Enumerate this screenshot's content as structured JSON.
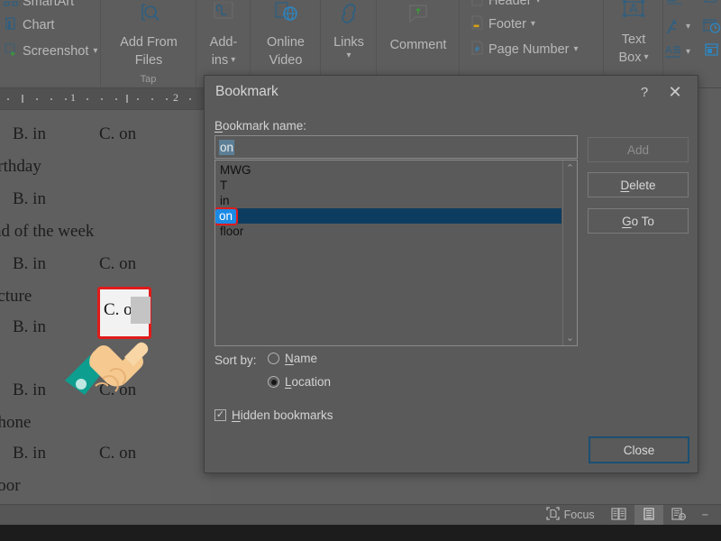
{
  "ribbon": {
    "groups": [
      {
        "name": "illustrations-group",
        "label": "",
        "items": [
          "SmartArt",
          "Chart",
          "Screenshot"
        ]
      },
      {
        "name": "tap-group",
        "label": "Tap",
        "items": [
          "Add From Files"
        ]
      },
      {
        "name": "addins-group",
        "label": "",
        "items": [
          "Add-ins"
        ]
      },
      {
        "name": "media-group",
        "label": "",
        "items": [
          "Online Video"
        ]
      },
      {
        "name": "links-group",
        "label": "",
        "items": [
          "Links"
        ]
      },
      {
        "name": "comments-group",
        "label": "",
        "items": [
          "Comment"
        ]
      },
      {
        "name": "header-footer-group",
        "label": "",
        "items": [
          "Header",
          "Footer",
          "Page Number"
        ]
      },
      {
        "name": "text-group",
        "label": "",
        "items": [
          "Text Box"
        ]
      }
    ],
    "smartart_label": "SmartArt",
    "chart_label": "Chart",
    "screenshot_label": "Screenshot",
    "add_from_files_label": "Add From\nFiles",
    "add_from_files_line1": "Add From",
    "add_from_files_line2": "Files",
    "tap_group_label": "Tap",
    "addins_line1": "Add-",
    "addins_line2": "ins",
    "online_video_line1": "Online",
    "online_video_line2": "Video",
    "links_label": "Links",
    "comment_label": "Comment",
    "header_label": "Header",
    "footer_label": "Footer",
    "page_number_label": "Page Number",
    "text_box_line1": "Text",
    "text_box_line2": "Box"
  },
  "ruler": {
    "marks": [
      "1",
      "2"
    ]
  },
  "document": {
    "lines": [
      {
        "answer_b": "B. in",
        "answer_c": "C. on",
        "trailing": ""
      },
      {
        "answer_b": "",
        "answer_c": "",
        "trailing": "irthday"
      },
      {
        "answer_b": "B. in",
        "answer_c": "C. on",
        "trailing": ""
      },
      {
        "answer_b": "",
        "answer_c": "",
        "trailing": "nd of the week"
      },
      {
        "answer_b": "B. in",
        "answer_c": "C. on",
        "trailing": ""
      },
      {
        "answer_b": "",
        "answer_c": "",
        "trailing": "icture"
      },
      {
        "answer_b": "B. in",
        "answer_c": "C. on",
        "trailing": ""
      },
      {
        "answer_b": "B. in",
        "answer_c": "C. on",
        "trailing": ""
      },
      {
        "answer_b": "",
        "answer_c": "",
        "trailing": "phone"
      },
      {
        "answer_b": "B. in",
        "answer_c": "C. on",
        "trailing": ""
      },
      {
        "answer_b": "",
        "answer_c": "",
        "trailing": "loor"
      }
    ],
    "highlighted_answer": "C. on"
  },
  "dialog": {
    "title": "Bookmark",
    "help_icon": "?",
    "close_icon": "✕",
    "bookmark_name_label": "Bookmark name:",
    "bookmark_name_label_accel": "B",
    "bookmark_name_label_rest": "ookmark name:",
    "bookmark_name_value": "on",
    "bookmarks": [
      "MWG",
      "T",
      "in",
      "on",
      "floor"
    ],
    "selected_bookmark": "on",
    "selected_index": 3,
    "buttons": {
      "add": {
        "label": "Add",
        "enabled": false
      },
      "delete_accel": "D",
      "delete_rest": "elete",
      "delete": "Delete",
      "goto_accel": "G",
      "goto_rest": "o To",
      "goto": "Go To",
      "close": "Close"
    },
    "sort_by_label": "Sort by:",
    "sort_options": [
      {
        "accel": "N",
        "rest": "ame",
        "label": "Name",
        "selected": false
      },
      {
        "accel": "L",
        "rest": "ocation",
        "label": "Location",
        "selected": true
      }
    ],
    "hidden_bookmarks": {
      "accel": "H",
      "rest": "idden bookmarks",
      "label": "Hidden bookmarks",
      "checked": true,
      "check_glyph": "✓"
    },
    "scroll_up_icon": "⌃",
    "scroll_down_icon": "⌄"
  },
  "statusbar": {
    "focus_label": "Focus",
    "view_buttons": [
      "read-mode",
      "print-layout",
      "web-layout"
    ],
    "active_view": "print-layout",
    "zoom_minus": "−"
  },
  "colors": {
    "dialog_bg": "#5a5a5a",
    "selection_blue": "#0d3c61",
    "selection_chip": "#1a8ae5",
    "highlight_red": "#e01b1b",
    "input_selection": "#5c7f96",
    "focus_border": "#1b4f72",
    "ribbon_icon": "#2e5f80"
  }
}
